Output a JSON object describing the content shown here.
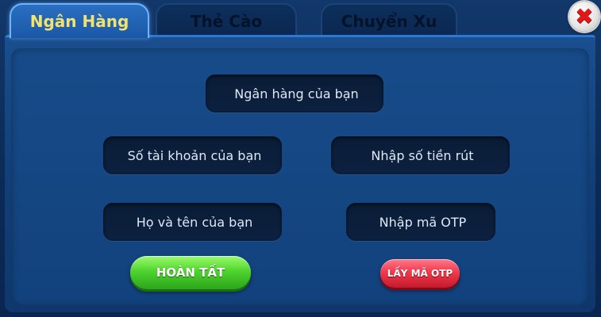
{
  "tabs": [
    {
      "label": "Ngân Hàng",
      "active": true
    },
    {
      "label": "Thẻ Cào",
      "active": false
    },
    {
      "label": "Chuyển Xu",
      "active": false
    }
  ],
  "close": {
    "icon": "close-x-icon",
    "glyph": "✖"
  },
  "form": {
    "bank_name_placeholder": "Ngân hàng của bạn",
    "account_number_placeholder": "Số tài khoản của bạn",
    "withdraw_amount_placeholder": "Nhập số tiền rút",
    "full_name_placeholder": "Họ và tên của bạn",
    "otp_placeholder": "Nhập mã OTP"
  },
  "buttons": {
    "complete_label": "HOÀN TẤT",
    "get_otp_label": "LẤY MÃ OTP"
  },
  "colors": {
    "active_tab_text": "#f3e36c",
    "complete_button": "#4fd42f",
    "otp_button": "#f03a4d",
    "close_x": "#e01818"
  }
}
